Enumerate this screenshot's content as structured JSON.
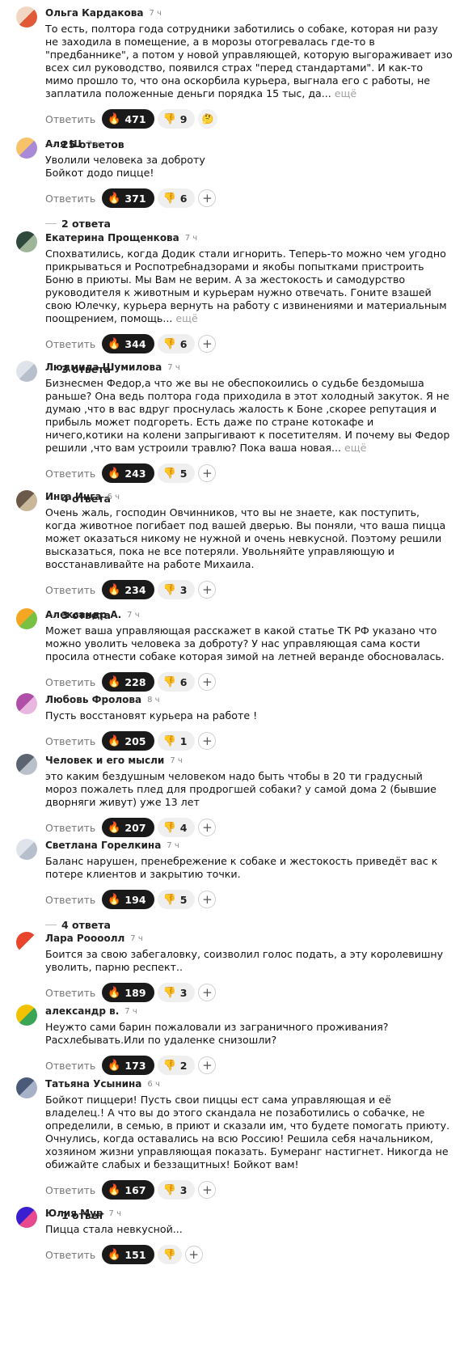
{
  "comments": [
    {
      "author": "Ольга Кардакова",
      "time": "7 ч",
      "text": "То есть, полтора года сотрудники заботились о собаке, которая ни разу не заходила в помещение, а в морозы отогревалась где-то в \"предбаннике\", а потом у новой управляющей, которую выгораживает изо всех сил руководство, появился страх \"перед стандартами\". И как-то мимо прошло то, что она оскорбила курьера, выгнала его с работы, не заплатила положенные деньги порядка 15 тыс, да...",
      "more": "ещё",
      "reply_label": "Ответить",
      "likes": "471",
      "dislikes": "9",
      "extra_icon": "thinking-face-icon",
      "replies": "25 ответов",
      "avatar_colors": [
        "#f2d6c4",
        "#e05a3a"
      ]
    },
    {
      "author": "Аля Ш",
      "time": "7 ч",
      "text": "Уволили человека за доброту\nБойкот додо пицце!",
      "more": "",
      "reply_label": "Ответить",
      "likes": "371",
      "dislikes": "6",
      "extra_icon": "plus-icon",
      "replies": "2 ответа",
      "avatar_colors": [
        "#f6c36a",
        "#a98ad6"
      ]
    },
    {
      "author": "Екатерина Прощенкова",
      "time": "7 ч",
      "text": "Спохватились, когда Додик стали игнорить. Теперь-то можно чем угодно прикрываться и Роспотребнадзорами и якобы попытками пристроить Боню в приюты. Мы Вам не верим. А за жестокость и самодурство руководителя к животным и курьерам нужно отвечать. Гоните взашей свою Юлечку, курьера вернуть на работу с извинениями и материальным поощрением, помощь...",
      "more": "ещё",
      "reply_label": "Ответить",
      "likes": "344",
      "dislikes": "6",
      "extra_icon": "plus-icon",
      "replies": "3 ответа",
      "avatar_colors": [
        "#2f4a3c",
        "#9fb59a"
      ]
    },
    {
      "author": "Людмила Шумилова",
      "time": "7 ч",
      "text": "Бизнесмен Федор,а что же вы не обеспокоились о судьбе бездомыша раньше? Она ведь полтора года приходила в этот холодный закуток. Я не думаю ,что в вас вдруг проснулась жалость к Боне ,скорее репутация и прибыль может подгореть. Есть даже по стране котокафе и ничего,котики на колени запрыгивают к посетителям. И почему вы Федор решили ,что вам устроили травлю? Пока ваша новая...",
      "more": "ещё",
      "reply_label": "Ответить",
      "likes": "243",
      "dislikes": "5",
      "extra_icon": "plus-icon",
      "replies": "4 ответа",
      "avatar_colors": [
        "#dfe3ea",
        "#b8bfcc"
      ]
    },
    {
      "author": "Инга Инга",
      "time": "6 ч",
      "text": "Очень жаль, господин Овчинников, что вы не знаете, как поступить, когда животное погибает под вашей дверью. Вы поняли, что ваша пицца может оказаться никому не нужной и очень невкусной. Поэтому решили высказаться, пока не все потеряли. Увольняйте управляющую и восстанавливайте на работе Михаила.",
      "more": "",
      "reply_label": "Ответить",
      "likes": "234",
      "dislikes": "3",
      "extra_icon": "plus-icon",
      "replies": "3 ответа",
      "avatar_colors": [
        "#6b5a4a",
        "#c9b79a"
      ]
    },
    {
      "author": "Александр А.",
      "time": "7 ч",
      "text": "Может ваша управляющая расскажет в какой статье ТК РФ указано что можно уволить человека за доброту? У нас управляющая сама кости просила отнести собаке которая зимой на летней веранде обосновалась.",
      "more": "",
      "reply_label": "Ответить",
      "likes": "228",
      "dislikes": "6",
      "extra_icon": "plus-icon",
      "replies": "",
      "avatar_colors": [
        "#f5a623",
        "#7ac143"
      ]
    },
    {
      "author": "Любовь Фролова",
      "time": "8 ч",
      "text": "Пусть восстановят курьера на работе !",
      "more": "",
      "reply_label": "Ответить",
      "likes": "205",
      "dislikes": "1",
      "extra_icon": "plus-icon",
      "replies": "",
      "avatar_colors": [
        "#b04fa8",
        "#e9b6e0"
      ]
    },
    {
      "author": "Человек и его мысли",
      "time": "7 ч",
      "text": "это каким бездушным человеком надо быть чтобы в 20 ти градусный мороз пожалеть плед для продрогшей собаки? у самой дома 2 (бывшие дворняги живут) уже 13 лет",
      "more": "",
      "reply_label": "Ответить",
      "likes": "207",
      "dislikes": "4",
      "extra_icon": "plus-icon",
      "replies": "",
      "avatar_colors": [
        "#5b6470",
        "#b9c0c9"
      ]
    },
    {
      "author": "Светлана Горелкина",
      "time": "7 ч",
      "text": "Баланс нарушен, пренебрежение к собаке и жестокость приведёт вас к потере клиентов и закрытию точки.",
      "more": "",
      "reply_label": "Ответить",
      "likes": "194",
      "dislikes": "5",
      "extra_icon": "plus-icon",
      "replies": "4 ответа",
      "avatar_colors": [
        "#dfe3ea",
        "#b8bfcc"
      ]
    },
    {
      "author": "Лара Роооолл",
      "time": "7 ч",
      "text": "Боится за свою забегаловку, соизволил голос подать, а эту королевишну уволить, парню респект..",
      "more": "",
      "reply_label": "Ответить",
      "likes": "189",
      "dislikes": "3",
      "extra_icon": "plus-icon",
      "replies": "",
      "avatar_colors": [
        "#e8452c",
        "#ffffff"
      ]
    },
    {
      "author": "александр в.",
      "time": "7 ч",
      "text": "Неужто сами барин пожаловали из заграничного проживания? Расхлебывать.Или по удаленке снизошли?",
      "more": "",
      "reply_label": "Ответить",
      "likes": "173",
      "dislikes": "2",
      "extra_icon": "plus-icon",
      "replies": "",
      "avatar_colors": [
        "#f2c200",
        "#3aa655"
      ]
    },
    {
      "author": "Татьяна Усынина",
      "time": "6 ч",
      "text": "Бойкот пиццери! Пусть свои пиццы ест сама управляющая и её владелец.! А что вы до этого скандала не позаботились о собачке, не определили, в семью, в приют и сказали им, что будете помогать приюту. Очнулись, когда оставались на всю Россию! Решила себя начальником, хозяином жизни управляющая показать. Бумеранг настигнет. Никогда не обижайте слабых и беззащитных! Бойкот вам!",
      "more": "",
      "reply_label": "Ответить",
      "likes": "167",
      "dislikes": "3",
      "extra_icon": "plus-icon",
      "replies": "1 ответ",
      "avatar_colors": [
        "#4c5a7a",
        "#a7b2c8"
      ]
    },
    {
      "author": "Юлия Мур",
      "time": "7 ч",
      "text": "Пицца стала невкусной...",
      "more": "",
      "reply_label": "Ответить",
      "likes": "151",
      "dislikes": "",
      "extra_icon": "plus-icon",
      "replies": "",
      "avatar_colors": [
        "#3a1fd1",
        "#e84a8f"
      ]
    }
  ]
}
